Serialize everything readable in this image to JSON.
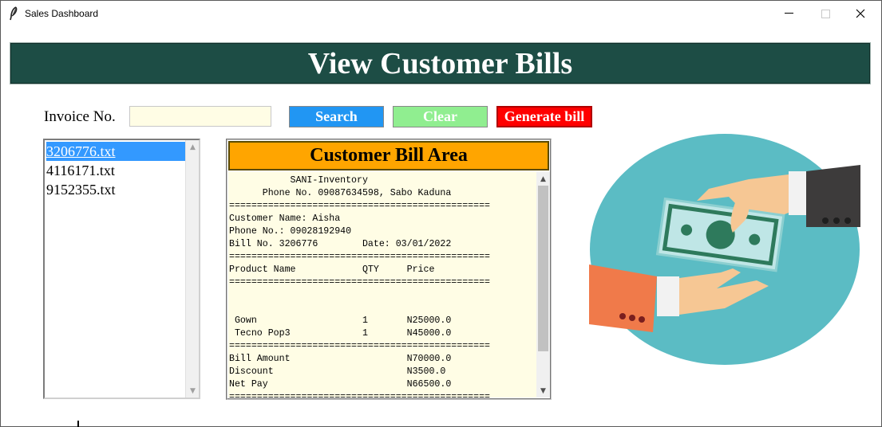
{
  "window": {
    "title": "Sales Dashboard",
    "minimize_icon": "minimize-icon",
    "maximize_icon": "maximize-icon",
    "close_icon": "close-icon"
  },
  "header": {
    "title": "View Customer Bills"
  },
  "search": {
    "label": "Invoice No.",
    "value": "",
    "placeholder": "",
    "search_button": "Search",
    "clear_button": "Clear",
    "generate_button": "Generate bill"
  },
  "colors": {
    "header_bg": "#1d4d45",
    "search_btn": "#2196f3",
    "clear_btn": "#90ee90",
    "generate_btn": "#ff0000",
    "bill_header": "#ffa500",
    "bill_bg": "#fffde5",
    "selected_item": "#3399ff"
  },
  "invoices": {
    "items": [
      "3206776.txt",
      "4116171.txt",
      "9152355.txt"
    ],
    "selected": "3206776.txt"
  },
  "bill": {
    "area_title": "Customer Bill Area",
    "lines": [
      "           SANI-Inventory",
      "      Phone No. 09087634598, Sabo Kaduna",
      "===============================================",
      "Customer Name: Aisha",
      "Phone No.: 09028192940",
      "Bill No. 3206776        Date: 03/01/2022",
      "===============================================",
      "Product Name            QTY     Price",
      "===============================================",
      "",
      "",
      " Gown                   1       N25000.0",
      " Tecno Pop3             1       N45000.0",
      "===============================================",
      "Bill Amount                     N70000.0",
      "Discount                        N3500.0",
      "Net Pay                         N66500.0",
      "==============================================="
    ]
  },
  "illustration": {
    "icon": "money-exchange-illustration"
  }
}
